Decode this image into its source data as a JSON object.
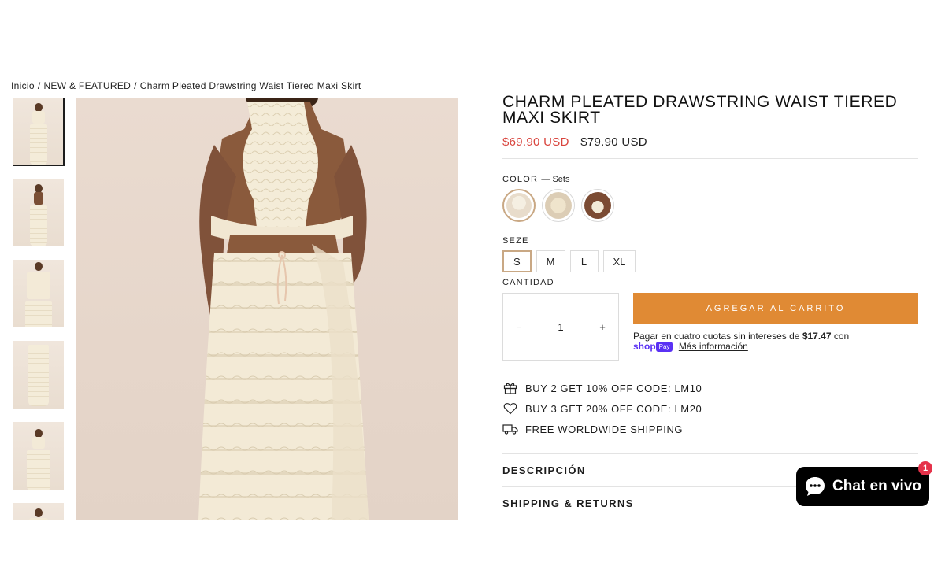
{
  "breadcrumb": {
    "home": "Inicio",
    "category": "NEW & FEATURED",
    "current": "Charm Pleated Drawstring Waist Tiered Maxi Skirt",
    "separator": "/"
  },
  "product": {
    "title": "CHARM PLEATED DRAWSTRING WAIST TIERED MAXI SKIRT",
    "price_sale": "$69.90 USD",
    "price_compare": "$79.90 USD"
  },
  "color": {
    "label": "COLOR",
    "selected": "— Sets",
    "swatches": [
      "set-top-and-skirt",
      "skirt-only",
      "top-only"
    ]
  },
  "size": {
    "label": "SEZE",
    "options": [
      "S",
      "M",
      "L",
      "XL"
    ],
    "selected": "S"
  },
  "quantity": {
    "label": "CANTIDAD",
    "minus": "−",
    "value": "1",
    "plus": "+"
  },
  "cart": {
    "button_label": "AGREGAR AL CARRITO"
  },
  "shoppay": {
    "text_before": "Pagar en cuatro cuotas sin intereses de",
    "amount": "$17.47",
    "text_after": "con",
    "logo": "shop",
    "badge": "Pay",
    "more_link": "Más información"
  },
  "promos": [
    {
      "icon": "gift-icon",
      "text": "BUY 2 GET 10% OFF CODE: LM10"
    },
    {
      "icon": "heart-icon",
      "text": "BUY 3 GET 20% OFF CODE: LM20"
    },
    {
      "icon": "truck-icon",
      "text": "FREE WORLDWIDE SHIPPING"
    }
  ],
  "accordion": [
    {
      "label": "DESCRIPCIÓN"
    },
    {
      "label": "SHIPPING & RETURNS"
    }
  ],
  "chat": {
    "label": "Chat en vivo",
    "badge": "1"
  },
  "colors": {
    "sale": "#d9453e",
    "cart_button": "#e08a34",
    "selected_outline": "#c9a884",
    "shoppay": "#5a31f4",
    "chat_bg": "#000000",
    "chat_badge": "#e5324a"
  }
}
